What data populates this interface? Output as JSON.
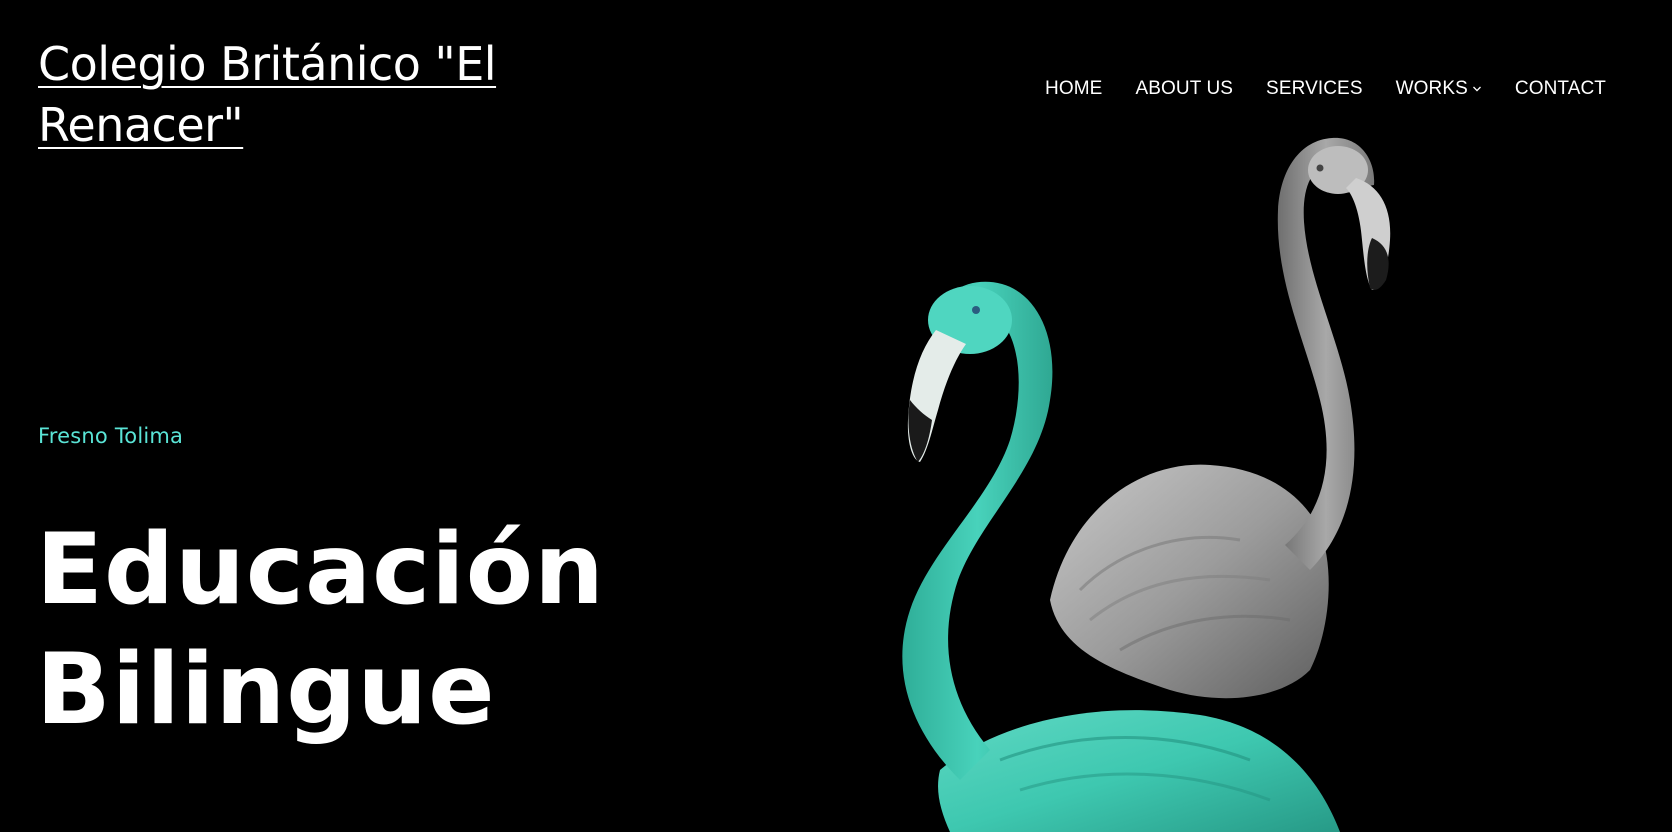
{
  "header": {
    "site_title": "Colegio Británico \"El Renacer\""
  },
  "nav": {
    "items": [
      {
        "label": "HOME"
      },
      {
        "label": "ABOUT US"
      },
      {
        "label": "SERVICES"
      },
      {
        "label": "WORKS",
        "has_dropdown": true
      },
      {
        "label": "CONTACT"
      }
    ]
  },
  "hero": {
    "tagline": "Fresno Tolima",
    "heading_line1": "Educación",
    "heading_line2": "Bilingue",
    "image_icon": "flamingo-illustration"
  },
  "colors": {
    "background": "#000000",
    "text": "#ffffff",
    "accent": "#5ae4d6",
    "flamingo_teal": "#3cc9b1",
    "flamingo_gray": "#9a9a9a"
  }
}
